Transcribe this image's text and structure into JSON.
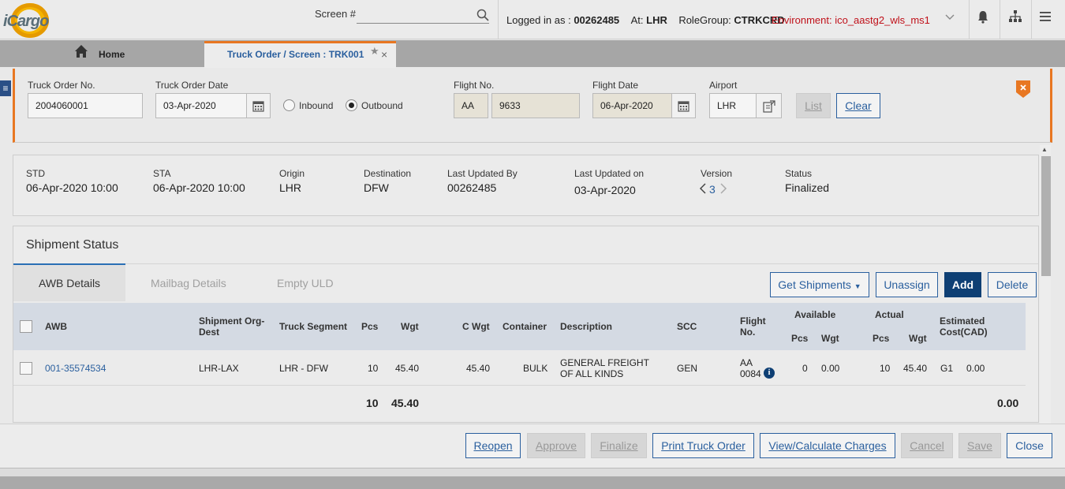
{
  "app": {
    "logo_text": "iCargo"
  },
  "topbar": {
    "screen_label": "Screen #",
    "screen_value": "",
    "logged_in_prefix": "Logged in as :",
    "user_id": "00262485",
    "at_prefix": "At:",
    "station": "LHR",
    "rolegroup_prefix": "RoleGroup:",
    "rolegroup": "CTRKCRD",
    "environment": "Environment: ico_aastg2_wls_ms1"
  },
  "tabs": {
    "home_label": "Home",
    "active_label": "Truck Order / Screen : TRK001"
  },
  "filter": {
    "truck_order_no_label": "Truck Order No.",
    "truck_order_no_value": "2004060001",
    "truck_order_date_label": "Truck Order Date",
    "truck_order_date_value": "03-Apr-2020",
    "inbound_label": "Inbound",
    "outbound_label": "Outbound",
    "direction_selected": "Outbound",
    "flight_no_label": "Flight No.",
    "flight_carrier": "AA",
    "flight_number": "9633",
    "flight_date_label": "Flight Date",
    "flight_date_value": "06-Apr-2020",
    "airport_label": "Airport",
    "airport_value": "LHR",
    "list_button": "List",
    "clear_button": "Clear"
  },
  "summary": {
    "std_label": "STD",
    "std_value": "06-Apr-2020 10:00",
    "sta_label": "STA",
    "sta_value": "06-Apr-2020 10:00",
    "origin_label": "Origin",
    "origin_value": "LHR",
    "destination_label": "Destination",
    "destination_value": "DFW",
    "last_updated_by_label": "Last Updated By",
    "last_updated_by_value": "00262485",
    "last_updated_on_label": "Last Updated on",
    "last_updated_on_value": "03-Apr-2020",
    "version_label": "Version",
    "version_value": "3",
    "status_label": "Status",
    "status_value": "Finalized"
  },
  "shipment": {
    "title": "Shipment Status",
    "tabs": [
      "AWB Details",
      "Mailbag Details",
      "Empty ULD"
    ],
    "get_shipments_button": "Get Shipments",
    "unassign_button": "Unassign",
    "add_button": "Add",
    "delete_button": "Delete",
    "columns": {
      "awb": "AWB",
      "org_dest_1": "Shipment Org-",
      "org_dest_2": "Dest",
      "truck_segment": "Truck Segment",
      "pcs": "Pcs",
      "wgt": "Wgt",
      "c_wgt": "C Wgt",
      "container": "Container",
      "description": "Description",
      "scc": "SCC",
      "flight_no_1": "Flight",
      "flight_no_2": "No.",
      "available": "Available",
      "available_pcs": "Pcs",
      "available_wgt": "Wgt",
      "actual": "Actual",
      "actual_pcs": "Pcs",
      "actual_wgt": "Wgt",
      "est_cost_1": "Estimated",
      "est_cost_2": "Cost(CAD)"
    },
    "rows": [
      {
        "awb": "001-35574534",
        "org_dest": "LHR-LAX",
        "truck_segment": "LHR - DFW",
        "pcs": "10",
        "wgt": "45.40",
        "c_wgt": "45.40",
        "container": "BULK",
        "description_1": "GENERAL FREIGHT",
        "description_2": "OF ALL KINDS",
        "scc": "GEN",
        "flight_1": "AA",
        "flight_2": "0084",
        "available_pcs": "0",
        "available_wgt": "0.00",
        "actual_pcs": "10",
        "actual_wgt": "45.40",
        "cost_code": "G1",
        "est_cost": "0.00"
      }
    ],
    "totals": {
      "pcs": "10",
      "wgt": "45.40",
      "est_cost": "0.00"
    }
  },
  "footer": {
    "reopen": "Reopen",
    "approve": "Approve",
    "finalize": "Finalize",
    "print": "Print Truck Order",
    "view_calc": "View/Calculate Charges",
    "cancel": "Cancel",
    "save": "Save",
    "close": "Close"
  },
  "colors": {
    "accent": "#e87722",
    "link": "#2a5f9e",
    "primary": "#0e3f74",
    "environment": "#c0111a"
  }
}
